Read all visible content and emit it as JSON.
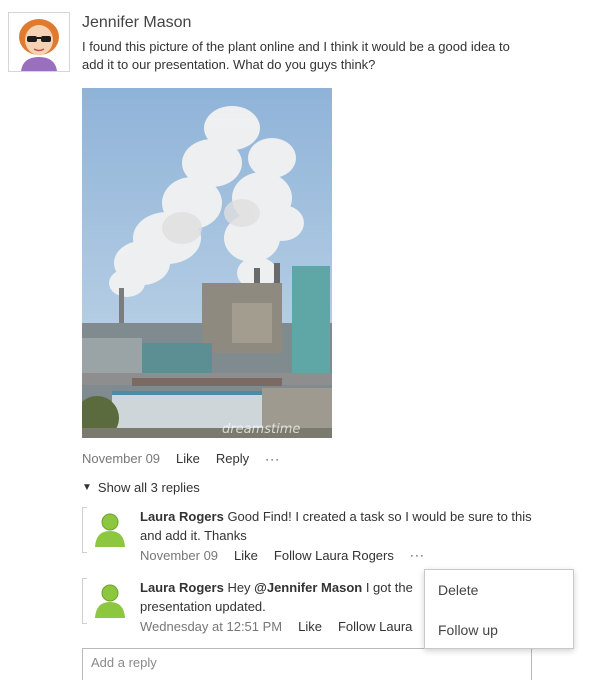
{
  "post": {
    "author": "Jennifer Mason",
    "text": "I found this picture of the plant online and I think it would be a good idea to add it to our presentation.  What do you guys think?",
    "image_watermark": "dreamstime",
    "date": "November 09",
    "like_label": "Like",
    "reply_label": "Reply",
    "more_label": "···"
  },
  "show_replies_label": "Show all 3 replies",
  "replies": [
    {
      "author": "Laura Rogers",
      "text": "Good Find!  I created a task so I would be sure to this and add it.  Thanks",
      "date": "November 09",
      "like_label": "Like",
      "follow_label": "Follow Laura Rogers",
      "more_label": "···"
    },
    {
      "author": "Laura Rogers",
      "text_before": "Hey ",
      "mention": "@Jennifer Mason",
      "text_after": " I got the presentation updated.",
      "date": "Wednesday at 12:51 PM",
      "like_label": "Like",
      "follow_label": "Follow Laura"
    }
  ],
  "context_menu": {
    "items": [
      "Delete",
      "Follow up"
    ]
  },
  "add_reply_placeholder": "Add a reply",
  "colors": {
    "text": "#333333",
    "meta": "#777777",
    "border": "#c8c8c8"
  }
}
